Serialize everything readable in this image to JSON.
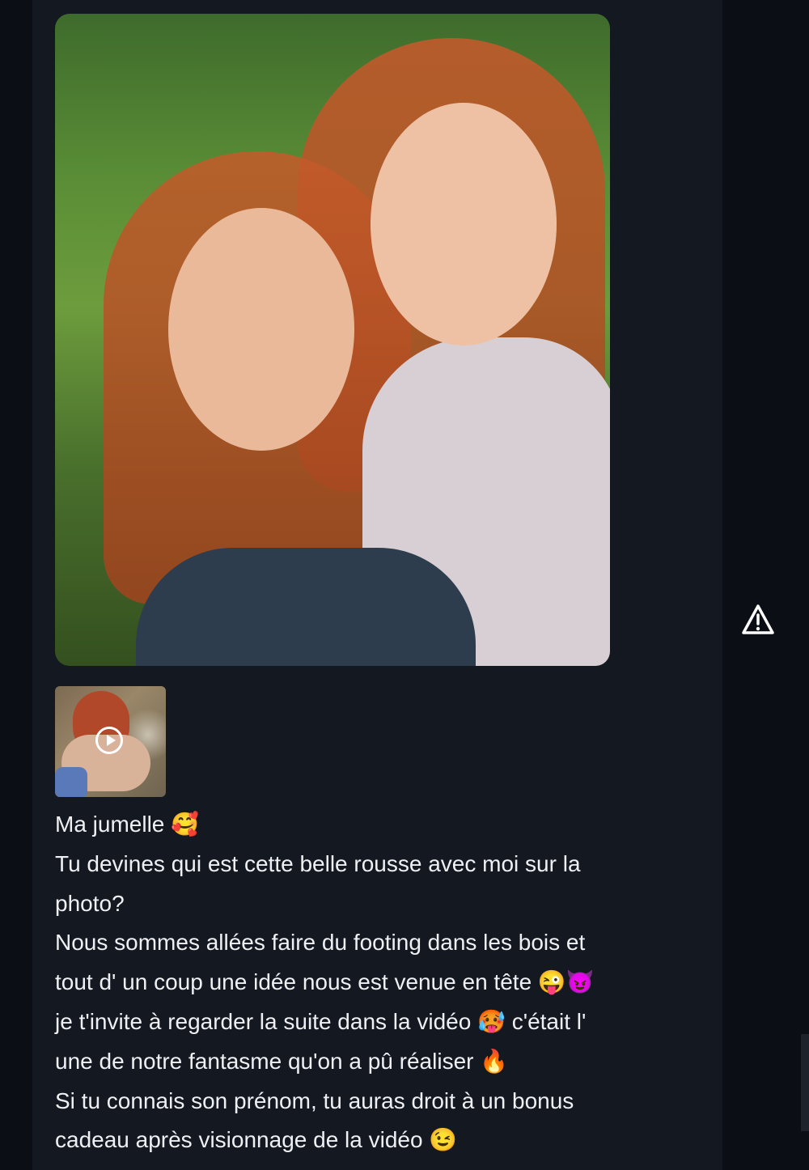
{
  "post": {
    "main_image": {
      "icon": "photo"
    },
    "video_thumbnail": {
      "icon": "play-icon"
    },
    "report_icon": "warning-triangle-icon",
    "caption_lines": [
      "Ma jumelle 🥰",
      "Tu devines qui est cette belle rousse avec moi sur la",
      "photo?",
      "Nous sommes allées faire du footing dans les bois et",
      "tout d' un coup une idée nous est venue en tête 😜😈",
      "je t'invite à regarder la suite dans la vidéo 🥵 c'était l'",
      "une de notre fantasme qu'on a pû réaliser 🔥",
      "Si tu connais son prénom, tu auras droit à un bonus",
      "cadeau après visionnage de la vidéo 😉"
    ]
  },
  "colors": {
    "background": "#0b0e14",
    "panel": "#141821",
    "text": "#eef0f3"
  }
}
